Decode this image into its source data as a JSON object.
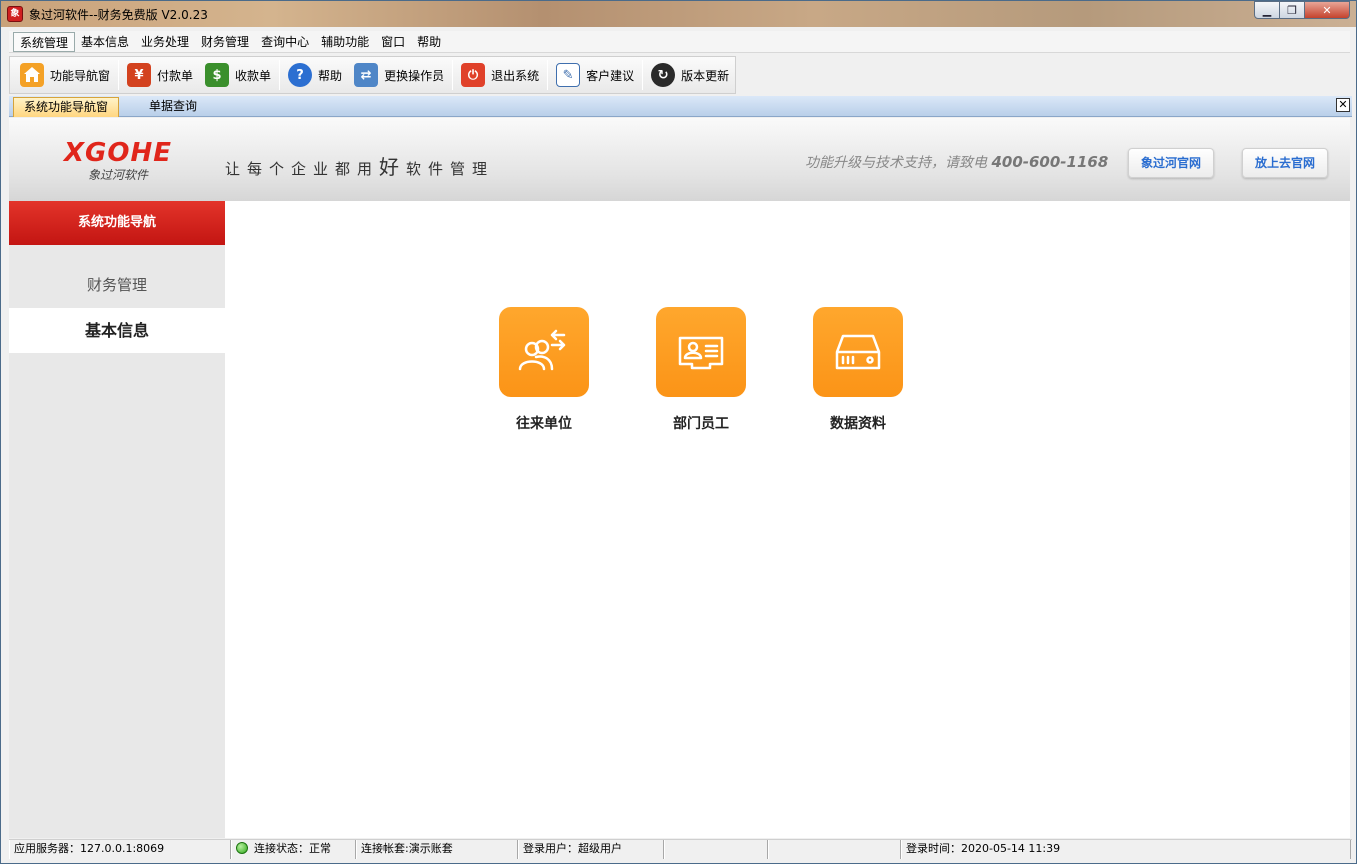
{
  "window": {
    "title": "象过河软件--财务免费版 V2.0.23",
    "app_icon_text": "象"
  },
  "menu": [
    "系统管理",
    "基本信息",
    "业务处理",
    "财务管理",
    "查询中心",
    "辅助功能",
    "窗口",
    "帮助"
  ],
  "toolbar": [
    {
      "label": "功能导航窗",
      "icon": "home-icon",
      "color": "#f19a21"
    },
    {
      "label": "付款单",
      "icon": "payment-voucher-icon",
      "color": "#d3421f"
    },
    {
      "label": "收款单",
      "icon": "receipt-voucher-icon",
      "color": "#3a8f2c"
    },
    {
      "label": "帮助",
      "icon": "help-icon",
      "color": "#2c6fd1"
    },
    {
      "label": "更换操作员",
      "icon": "switch-user-icon",
      "color": "#4f86c7"
    },
    {
      "label": "退出系统",
      "icon": "power-icon",
      "color": "#e0412a"
    },
    {
      "label": "客户建议",
      "icon": "notepad-icon",
      "color": "#3f6fae"
    },
    {
      "label": "版本更新",
      "icon": "update-icon",
      "color": "#2a2a2a"
    }
  ],
  "tabs": {
    "active": "系统功能导航窗",
    "inactive": "单据查询",
    "close": "✕"
  },
  "banner": {
    "logo_main": "XGOHE",
    "logo_sub": "象过河软件",
    "slogan_a": "让每个企业都用",
    "slogan_big": "好",
    "slogan_b": "软件管理",
    "support_text": "功能升级与技术支持，请致电",
    "support_phone": "400-600-1168",
    "site_button_1": "象过河官网",
    "site_button_2": "放上去官网"
  },
  "sidebar": {
    "header": "系统功能导航",
    "items": [
      "财务管理",
      "基本信息"
    ],
    "active_index": 1
  },
  "tiles": [
    {
      "label": "往来单位",
      "icon": "contacts-exchange-icon"
    },
    {
      "label": "部门员工",
      "icon": "employee-card-icon"
    },
    {
      "label": "数据资料",
      "icon": "hard-drive-icon"
    }
  ],
  "status": {
    "server": "应用服务器：127.0.0.1:8069",
    "connection": "连接状态：正常",
    "account": "连接帐套:演示账套",
    "user": "登录用户：超级用户",
    "blank1": "",
    "blank2": "",
    "login_time": "登录时间：2020-05-14 11:39"
  }
}
